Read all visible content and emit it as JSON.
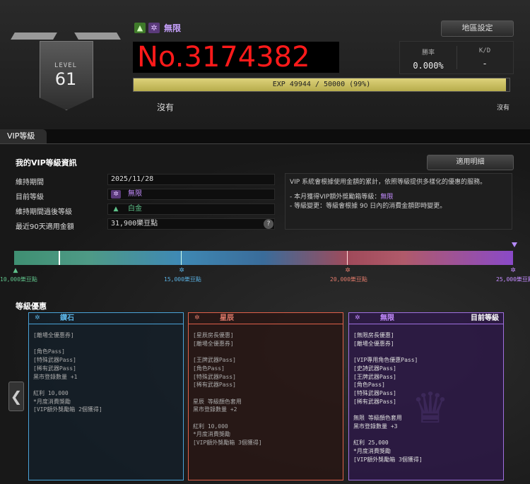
{
  "header": {
    "level_label": "LEVEL",
    "level": "61",
    "tier_name": "無限",
    "player_id": "No.3174382",
    "region_button": "地區設定",
    "win_rate_label": "勝率",
    "win_rate": "0.000%",
    "kd_label": "K/D",
    "kd": "-",
    "exp_text": "EXP 49944 / 50000 (99%)",
    "exp_progress": 0.99,
    "nothing_main": "沒有",
    "nothing_right": "沒有"
  },
  "tab": {
    "label": "VIP等級"
  },
  "vip_info": {
    "title": "我的VIP等級資訊",
    "apply_button": "適用明細",
    "rows": [
      {
        "label": "維持期間",
        "value": "2025/11/28"
      },
      {
        "label": "目前等級",
        "value": "無限"
      },
      {
        "label": "維持期間過後等級",
        "value": "白金"
      },
      {
        "label": "最近90天適用金額",
        "value": "31,900樂豆點"
      }
    ],
    "help": "?",
    "desc_line1": "VIP 系統會根據使用金額的累計，依照等級提供多樣化的優惠的服務。",
    "desc_line2_prefix": "- 本月獲得VIP額外獎勵箱等級：",
    "desc_line2_value": "無限",
    "desc_line3": "- 等級變更：等級會根據 90 日內的消費金額即時變更。"
  },
  "progress": {
    "labels": [
      "10,000樂豆點",
      "15,000樂豆點",
      "20,000樂豆點",
      "25,000樂豆點"
    ],
    "colors": [
      "#5fc28a",
      "#5ab0e0",
      "#e07a6a",
      "#c48cff"
    ]
  },
  "benefits": {
    "title": "等級優惠",
    "cards": [
      {
        "name": "鑽石",
        "color": "#4aa3d8",
        "lines": [
          "[離場全優惠券]",
          "",
          "[角色Pass]",
          "[特殊武器Pass]",
          "[稀有武器Pass]",
          "黑市登錄數量 +1",
          "",
          "紅利 10,000",
          "*月度消費獎勵",
          "[VIP額外獎勵箱 2個獲得]"
        ]
      },
      {
        "name": "星辰",
        "color": "#e0604a",
        "lines": [
          "[星辰房長優惠]",
          "[離場全優惠券]",
          "",
          "[王牌武器Pass]",
          "[角色Pass]",
          "[特殊武器Pass]",
          "[稀有武器Pass]",
          "",
          "星辰 等級顏色套用",
          "黑市登錄數量 +2",
          "",
          "紅利 10,000",
          "*月度消費獎勵",
          "[VIP額外獎勵箱 3個獲得]"
        ]
      },
      {
        "name": "無限",
        "current": "目前等級",
        "color": "#a070e0",
        "lines": [
          "[無限房長優惠]",
          "[離場全優惠券]",
          "",
          "[VIP專用角色優惠Pass]",
          "[史詩武器Pass]",
          "[王牌武器Pass]",
          "[角色Pass]",
          "[特殊武器Pass]",
          "[稀有武器Pass]",
          "",
          "無限 等級顏色套用",
          "黑市登錄數量 +3",
          "",
          "紅利 25,000",
          "*月度消費獎勵",
          "[VIP額外獎勵箱 3個獲得]"
        ]
      }
    ],
    "prev_arrow": "❮"
  }
}
